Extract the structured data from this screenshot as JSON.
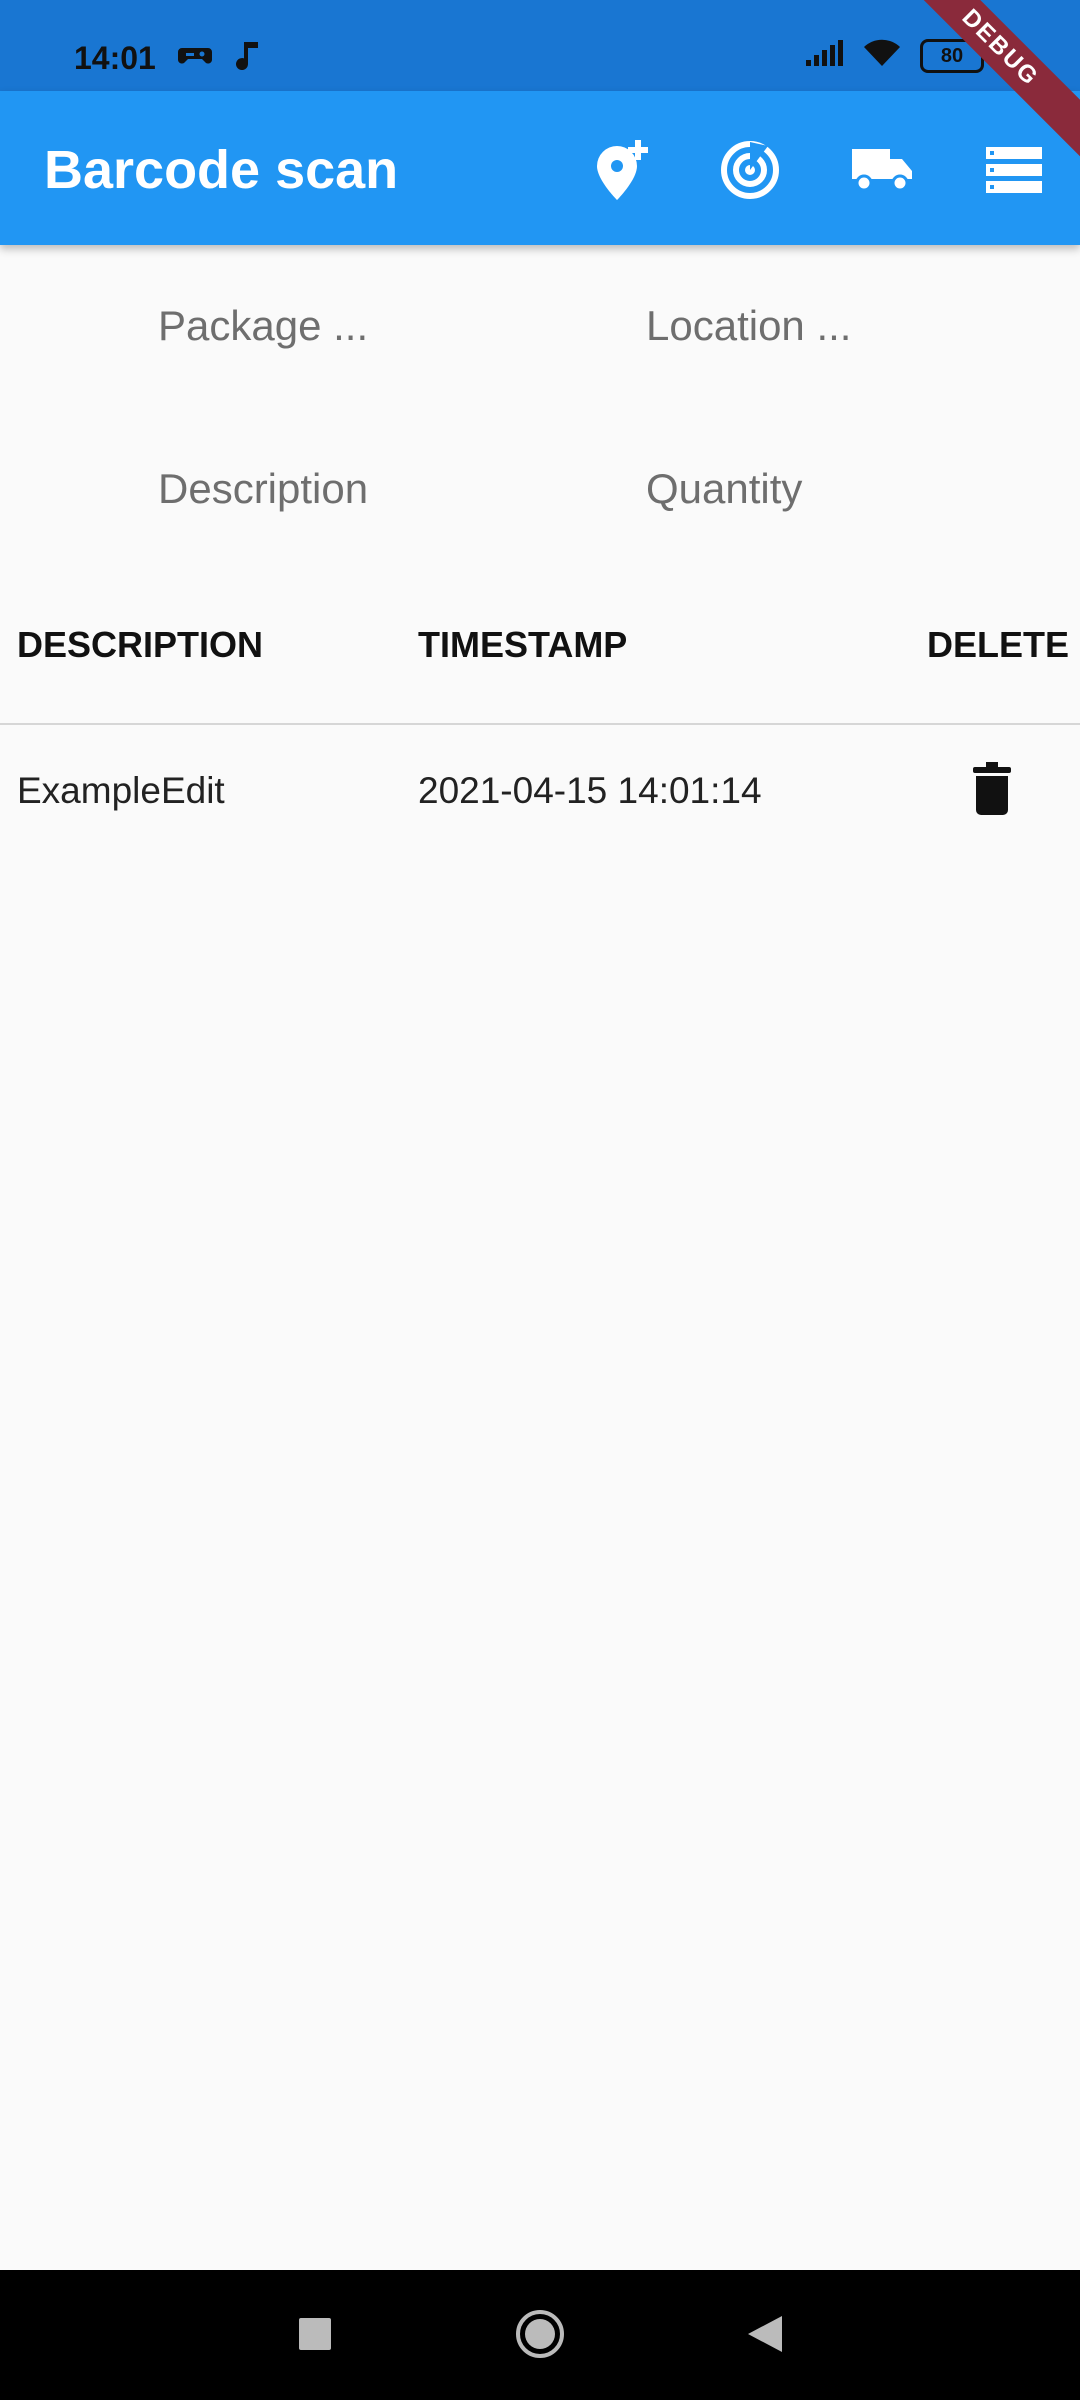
{
  "status": {
    "time": "14:01",
    "battery": "80"
  },
  "debug_banner": "DEBUG",
  "app_bar": {
    "title": "Barcode scan",
    "actions": [
      "add-location-icon",
      "radar-icon",
      "truck-icon",
      "storage-list-icon"
    ]
  },
  "form": {
    "package_placeholder": "Package ...",
    "location_placeholder": "Location ...",
    "description_placeholder": "Description",
    "quantity_placeholder": "Quantity"
  },
  "table": {
    "headers": [
      "DESCRIPTION",
      "TIMESTAMP",
      "DELETE"
    ],
    "rows": [
      {
        "description": "ExampleEdit",
        "timestamp": "2021-04-15 14:01:14"
      }
    ]
  },
  "colors": {
    "app_bar": "#2196f3",
    "status_bar": "#1976d2",
    "background": "#fafafa"
  }
}
